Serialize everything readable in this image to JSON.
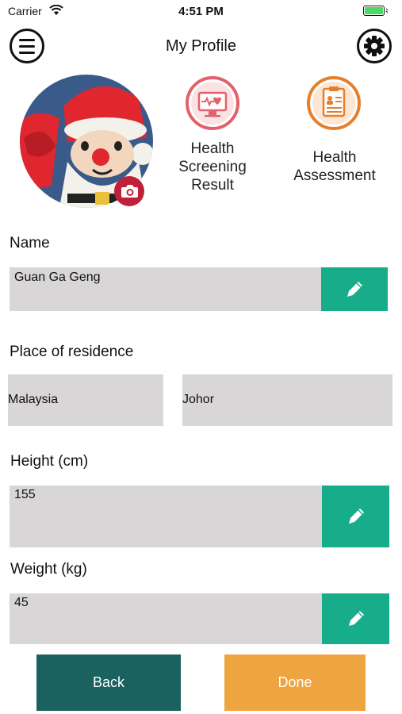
{
  "status_bar": {
    "carrier": "Carrier",
    "time": "4:51 PM"
  },
  "header": {
    "title": "My Profile",
    "menu_icon": "hamburger-menu-icon",
    "settings_icon": "gear-icon"
  },
  "shortcuts": [
    {
      "label_lines": [
        "Health",
        "Screening",
        "Result"
      ],
      "icon": "monitor-heart-icon",
      "color": "#e4606a"
    },
    {
      "label_lines": [
        "Health",
        "Assessment"
      ],
      "icon": "clipboard-icon",
      "color": "#e77f2a"
    }
  ],
  "profile": {
    "name_label": "Name",
    "name_value": "Guan Ga Geng",
    "residence_label": "Place of residence",
    "country_value": "Malaysia",
    "state_value": "Johor",
    "height_label": "Height (cm)",
    "height_value": "155",
    "weight_label": "Weight (kg)",
    "weight_value": "45"
  },
  "actions": {
    "back_label": "Back",
    "done_label": "Done"
  },
  "colors": {
    "edit_button": "#17ad8a",
    "back_button": "#1a6160",
    "done_button": "#eea53f",
    "field_bg": "#d8d6d6",
    "camera_button": "#c0203a"
  }
}
